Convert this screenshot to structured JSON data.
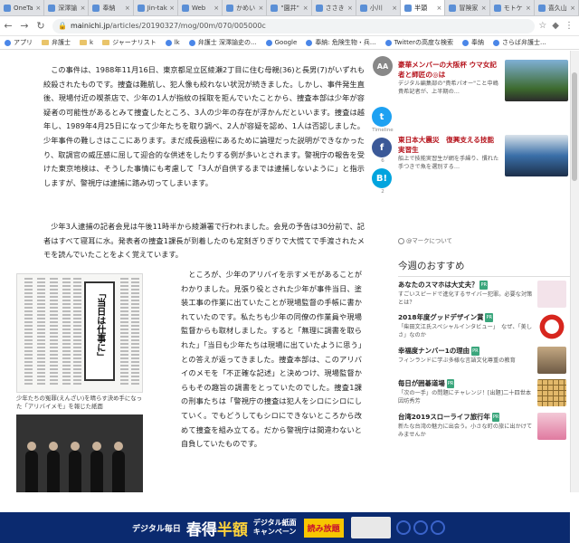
{
  "browser": {
    "tabs": [
      {
        "label": "OneTa"
      },
      {
        "label": "深澤諭"
      },
      {
        "label": "奉納"
      },
      {
        "label": "Jin-tak"
      },
      {
        "label": "Web"
      },
      {
        "label": "かめい"
      },
      {
        "label": "\"園井\""
      },
      {
        "label": "ささき"
      },
      {
        "label": "小川"
      },
      {
        "label": "半頭",
        "active": true
      },
      {
        "label": "冒険家"
      },
      {
        "label": "モトケ"
      },
      {
        "label": "喜久山"
      }
    ],
    "url_host": "mainichi.jp",
    "url_path": "/articles/20190327/mog/00m/070/005000c",
    "bookmarks": [
      "アプリ",
      "弁護士",
      "k",
      "ジャーナリスト",
      "lk",
      "弁護士 深澤諭史の...",
      "Google",
      "奉納: 危険生物・兵...",
      "Twitterの高度な検索",
      "奉納",
      "さらば弁護士..."
    ]
  },
  "article": {
    "p1": "この事件は、1988年11月16日、東京都足立区綾瀬2丁目に住む母親(36)と長男(7)がいずれも絞殺されたものです。捜査は難航し、犯人像も絞れない状況が続きました。しかし、事件発生直後、現場付近の喫茶店で、少年の1人が指紋の採取を拒んでいたことから、捜査本部は少年が容疑者の可能性があるとみて捜査したところ、3人の少年の存在が浮かんだといいます。捜査は越年し、1989年4月25日になって少年たちを取り調べ、2人が容疑を認め、1人は否認しました。少年事件の難しさはここにあります。まだ成長過程にあるために論理だった説明ができなかったり、取調官の威圧感に屈して迎合的な供述をしたりする例が多いとされます。警視庁の報告を受けた東京地検は、そうした事情にも考慮して「3人が自供するまでは逮捕しないように」と指示しますが、警視庁は逮捕に踏み切ってしまいます。",
    "p2": "少年3人逮捕の記者会見は午後11時半から綾瀬署で行われました。会見の予告は30分前で、記者はすべて寝耳に水。発表者の捜査1課長が到着したのも定刻ぎりぎりで大慌てで手渡されたメモを読んでいたことをよく覚えています。",
    "p3": "ところが、少年のアリバイを示すメモがあることがわかりました。見張り役とされた少年が事件当日、塗装工事の作業に出ていたことが現場監督の手帳に書かれていたのです。私たちも少年の同僚の作業員や現場監督からも取材しました。すると「無理に調書を取られた」「当日も少年たちは現場に出ていたように思う」との答えが返ってきました。捜査本部は、このアリバイのメモを「不正確な記述」と決めつけ、現場監督からもその趣旨の調書をとっていたのでした。捜査1課の刑事たちは「警視庁の捜査は犯人をシロにシロにしていく。でもどうしてもシロにできないところから改めて捜査を組み立てる。だから警視庁は間違わないと自負していたものです。",
    "newspaper_headline": "「当日は仕事に」",
    "caption": "少年たちの冤罪(えんざい)を晴らす決め手になった「アリバイメモ」を報じた紙面"
  },
  "share": {
    "aa_label": "AA",
    "twitter_count": "Timeline",
    "facebook_count": "6",
    "hatena_count": "2"
  },
  "sidebar": {
    "cards": [
      {
        "title": "豪華メンバーの大阪杯 ウマ女記者と師匠の◎は",
        "desc": "デジタル編集部の\"貴希パオー\"こと中嶋貴希記者が、上半期の…"
      },
      {
        "title": "東日本大震災　復興支える技能実習生",
        "desc": "船上で技能実習生が網を手繰り、慣れた手つきで魚を選別する…"
      }
    ],
    "ad_mark": "@マークについて",
    "rec_title": "今週のおすすめ",
    "recs": [
      {
        "title": "あなたのスマホは大丈夫？",
        "desc": "すごいスピードで進化するサイバー犯罪。必要な対策とは？"
      },
      {
        "title": "2018年度グッドデザイン賞",
        "desc": "「柴田文江氏スペシャルインタビュー」　なぜ、「美しさ」なのか"
      },
      {
        "title": "幸福度ナンバー1の理由",
        "desc": "フィンランドに学ぶ多様な言語文化尊重の教育"
      },
      {
        "title": "毎日が囲碁道場",
        "desc": "「次の一手」の問題にチャレンジ！[出題]二十四世本因坊秀芳"
      },
      {
        "title": "台湾2019スローライフ旅行年",
        "desc": "新たな台湾の魅力に出会う。小さな町の旅に出かけてみませんか"
      }
    ],
    "pr_label": "PR"
  },
  "bottom_ad": {
    "logo": "デジタル毎日",
    "headline_a": "春得",
    "headline_b": "半額",
    "sub_line1": "デジタル紙面",
    "sub_line2": "キャンペーン",
    "badge": "読み放題"
  }
}
